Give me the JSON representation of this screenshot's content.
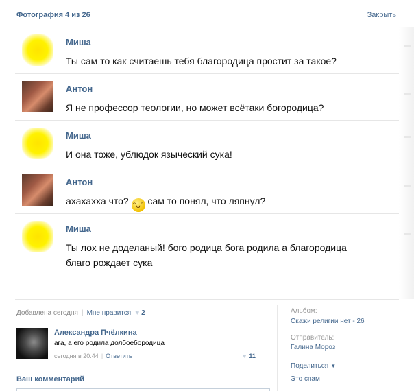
{
  "header": {
    "title": "Фотография 4 из 26",
    "close_label": "Закрыть"
  },
  "messages": [
    {
      "author": "Миша",
      "avatar": "blurred-avatar",
      "text": "Ты сам то как считаешь тебя благородица простит за такое?"
    },
    {
      "author": "Антон",
      "avatar": "photo-avatar",
      "text": "Я не профессор теологии, но может всётаки богородица?"
    },
    {
      "author": "Миша",
      "avatar": "blurred-avatar",
      "text": "И она тоже, ублюдок языческий сука!"
    },
    {
      "author": "Антон",
      "avatar": "photo-avatar",
      "text_before": "ахахахха что?",
      "emoji": "laughing-face-emoji",
      "text_after": "сам то понял, что ляпнул?"
    },
    {
      "author": "Миша",
      "avatar": "blurred-avatar",
      "text_line1": "Ты лох не доделаный! бого родица бога родила а благородица",
      "text_line2": "благо рождает сука"
    }
  ],
  "photo_meta": {
    "added": "Добавлена сегодня",
    "like_label": "Мне нравится",
    "like_count": "2"
  },
  "comment": {
    "author": "Александра Пчёлкина",
    "text": "ага, а его родила долбоебородица",
    "time": "сегодня в 20:44",
    "reply_label": "Ответить",
    "likes": "11"
  },
  "your_comment_label": "Ваш комментарий",
  "sidebar": {
    "album_label": "Альбом:",
    "album_name": "Скажи религии нет - 26",
    "sender_label": "Отправитель:",
    "sender_name": "Галина Мороз",
    "share_label": "Поделиться",
    "spam_label": "Это спам"
  },
  "colors": {
    "link": "#45688e",
    "highlight_avatar": "#fff200"
  }
}
